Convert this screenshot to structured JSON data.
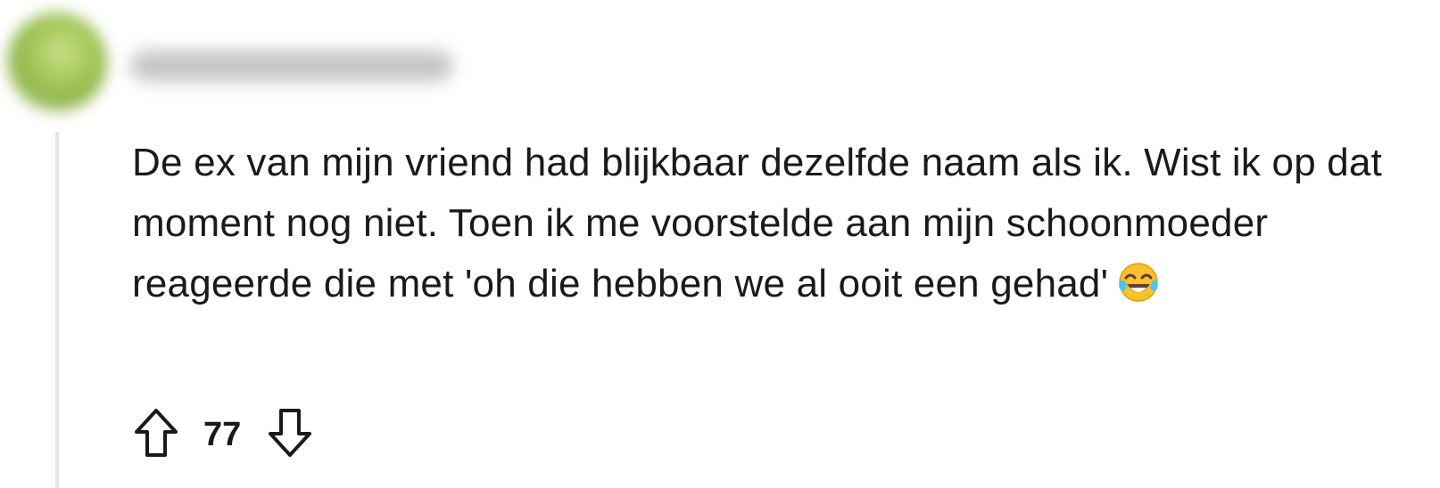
{
  "comment": {
    "author": "",
    "body": "De ex van mijn vriend had blijkbaar dezelfde naam als ik. Wist ik op dat moment nog niet. Toen ik me voorstelde aan mijn schoonmoeder reageerde die met 'oh die hebben we al ooit een gehad'",
    "emoji": "face-with-tears-of-joy",
    "score": "77"
  },
  "icons": {
    "upvote": "upvote-arrow-icon",
    "downvote": "downvote-arrow-icon"
  },
  "colors": {
    "text": "#1a1a1b",
    "thread_line": "#e3e5e8",
    "emoji_face": "#fbc02d",
    "emoji_tears": "#4fc3f7"
  }
}
